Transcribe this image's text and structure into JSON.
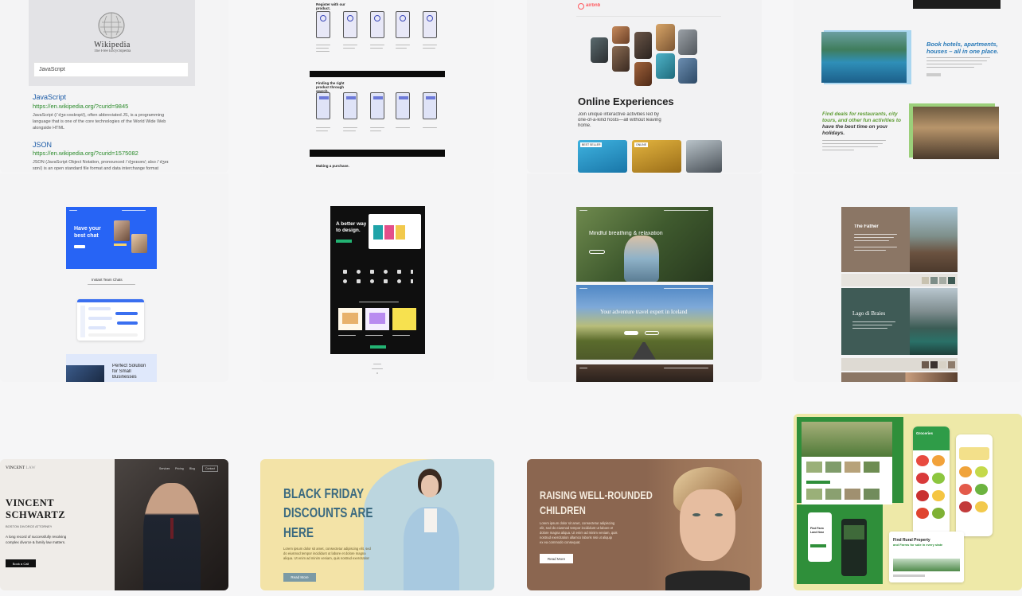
{
  "colors": {
    "page_bg": "#f6f6f7",
    "card_bg": "#f0f0f2",
    "wiki_link": "#1a5aa6",
    "wiki_url": "#2a8a2a",
    "airbnb": "#ff5a5f",
    "chat_blue": "#2764f5",
    "vincent_dark": "#2b2624",
    "vincent_btn": "#111111",
    "bf_yellow": "#f3e3a7",
    "bf_blue": "#bcd6df",
    "bf_text": "#3b6a80",
    "kids_brown": "#8b6650",
    "farm_green": "#2f8f3a",
    "farm_yellow": "#eee9a8",
    "trav_green": "#5e9c34",
    "trav_blue": "#2a7ab8"
  },
  "wiki": {
    "brand": "Wikipedia",
    "tagline": "The Free Encyclopedia",
    "search_value": "JavaScript",
    "results": [
      {
        "title": "JavaScript",
        "url": "https://en.wikipedia.org/?curid=9845",
        "snippet": [
          "JavaScript (/ˈdʒɑːvəskrɪpt/), often abbreviated JS, is a programming",
          "language that is one of the core technologies of the World Wide Web",
          "alongside HTML"
        ]
      },
      {
        "title": "JSON",
        "url": "https://en.wikipedia.org/?curid=1575082",
        "snippet": [
          "JSON (JavaScript Object Notation, pronounced /ˈdʒeɪsən/; also /ˈdʒeɪ",
          "sɒn/) is an open standard file format and data interchange format"
        ]
      }
    ]
  },
  "flow": {
    "section1": "Register with our product.",
    "section2": "Finding the right product through search.",
    "section3": "Making a purchase."
  },
  "airbnb": {
    "logo": "airbnb",
    "heading": "Online Experiences",
    "subtitle": [
      "Join unique interactive activities led by",
      "one-of-a-kind hosts—all without leaving",
      "home."
    ],
    "badge1": "BEST SELLER",
    "badge2": "ONLINE"
  },
  "travel": {
    "headline1": [
      "Book hotels, apartments,",
      "houses – all in one place."
    ],
    "headline2": [
      "Find deals for restaurants, city",
      "tours, and other fun activities to",
      "have the best time on your",
      "holidays."
    ]
  },
  "chat": {
    "hero": [
      "Have your",
      "best chat"
    ],
    "section": "Instant Team Chats",
    "bottom": [
      "Perfect Solution",
      "for Small",
      "Businesses"
    ]
  },
  "design": {
    "headline": [
      "A better way",
      "to design."
    ]
  },
  "nature": {
    "hero": "Mindful breathing & relaxation",
    "iceland": "Your adventure travel expert in Iceland"
  },
  "father": {
    "title": "The Father",
    "lake": "Lago di Braies",
    "swatches": [
      "#c8c2b0",
      "#7d8d88",
      "#a6aca4",
      "#3f5a54",
      "#24413c",
      "#1e3734"
    ],
    "swatches2": [
      "#6d5a4c",
      "#3b3330",
      "#d8d2c6",
      "#8e7c6c",
      "#2a2522"
    ]
  },
  "vincent": {
    "logo": "VINCENT",
    "logo_suffix": "LAW",
    "name_line1": "VINCENT",
    "name_line2": "SCHWARTZ",
    "role": "BOSTON DIVORCE ATTORNEY",
    "desc": [
      "A long record of successfully resolving",
      "complex divorce & family law matters."
    ],
    "button": "Book a Call",
    "nav": [
      "Services",
      "Pricing",
      "Blog",
      "Contact"
    ]
  },
  "blackfriday": {
    "headline": [
      "BLACK FRIDAY",
      "DISCOUNTS ARE",
      "HERE"
    ],
    "body": [
      "Lorem ipsum dolor sit amet, consectetur adipiscing elit, sed",
      "do eiusmod tempor incididunt ut labore et dolore magna",
      "aliqua. Ut enim ad minim veniam, quis nostrud exercitation"
    ],
    "button": "Read More"
  },
  "kids": {
    "headline": [
      "RAISING WELL-ROUNDED",
      "CHILDREN"
    ],
    "body": [
      "Lorem ipsum dolor sit amet, consectetur adipiscing",
      "elit, sed do eiusmod tempor incididunt ut labore et",
      "dolore magna aliqua. Ut enim ad minim veniam, quis",
      "nostrud exercitation ullamco laboris nisi ut aliquip",
      "ex ea commodo consequat."
    ],
    "button": "Read More"
  },
  "farm": {
    "app_title": "Groceries",
    "title": [
      "Find Rural Property",
      "and Farms for sale in every state"
    ],
    "side": [
      "Find Farm",
      "Land Near"
    ]
  }
}
